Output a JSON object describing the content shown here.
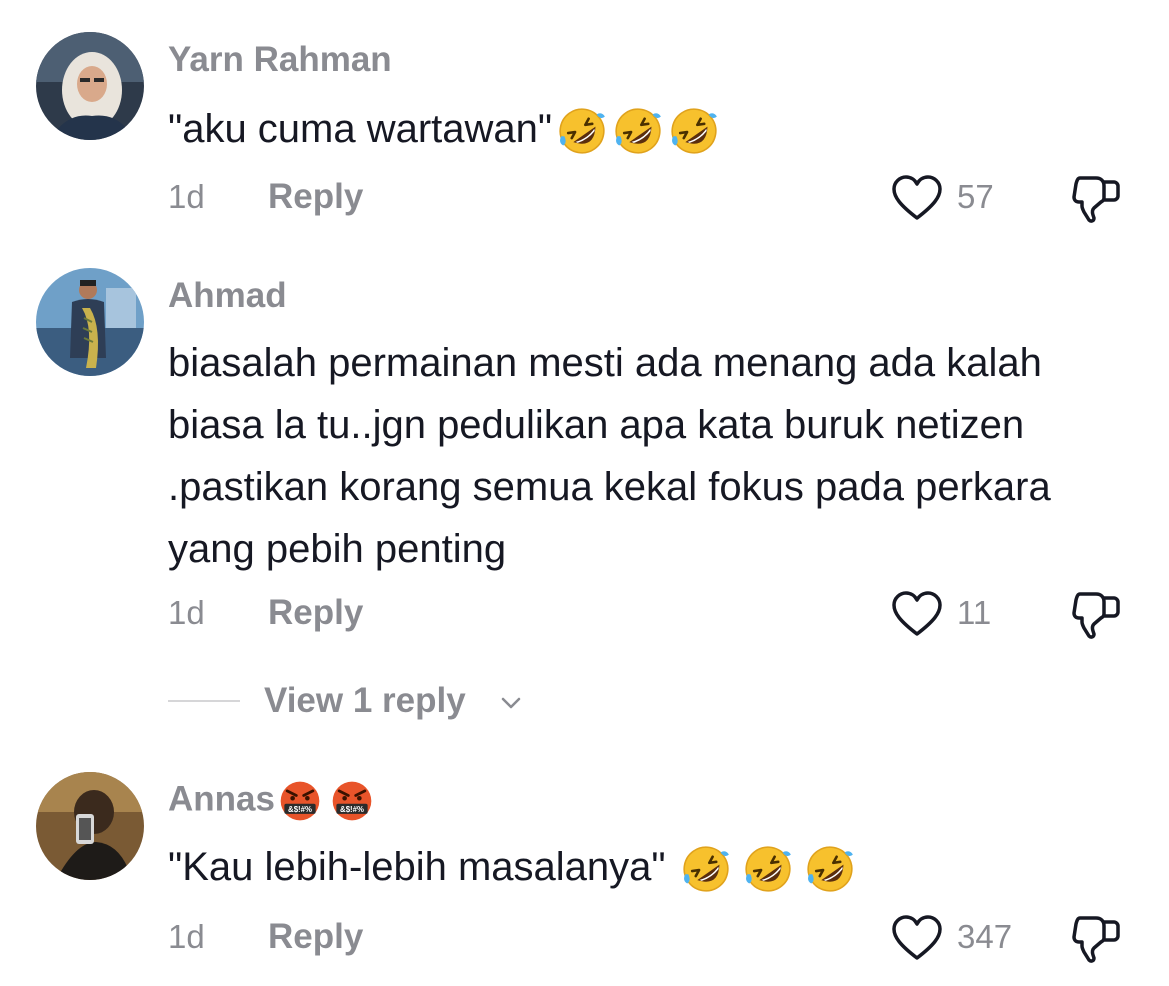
{
  "comments": [
    {
      "username": "Yarn Rahman",
      "avatar_icon": "avatar-hijab-woman",
      "text": "\"aku cuma wartawan\"",
      "emojis": [
        "rolling-on-floor-laughing",
        "rolling-on-floor-laughing",
        "rolling-on-floor-laughing"
      ],
      "time": "1d",
      "reply_label": "Reply",
      "likes": "57"
    },
    {
      "username": "Ahmad",
      "avatar_icon": "avatar-man-holding-fish",
      "text": "biasalah permainan mesti ada menang ada kalah biasa la tu..jgn pedulikan apa kata buruk netizen .pastikan korang semua kekal fokus pada perkara yang pebih penting",
      "time": "1d",
      "reply_label": "Reply",
      "likes": "11",
      "view_replies_label": "View 1 reply"
    },
    {
      "username": "Annas",
      "username_emojis": [
        "face-with-symbols-on-mouth",
        "face-with-symbols-on-mouth"
      ],
      "avatar_icon": "avatar-mirror-selfie",
      "text": "\"Kau lebih-lebih masalanya\"",
      "emojis": [
        "rolling-on-floor-laughing",
        "rolling-on-floor-laughing",
        "rolling-on-floor-laughing"
      ],
      "time": "1d",
      "reply_label": "Reply",
      "likes": "347"
    }
  ],
  "colors": {
    "text": "#161823",
    "muted": "#8a8b91",
    "emoji_yellow": "#f7c12d",
    "emoji_red": "#e8542a"
  }
}
